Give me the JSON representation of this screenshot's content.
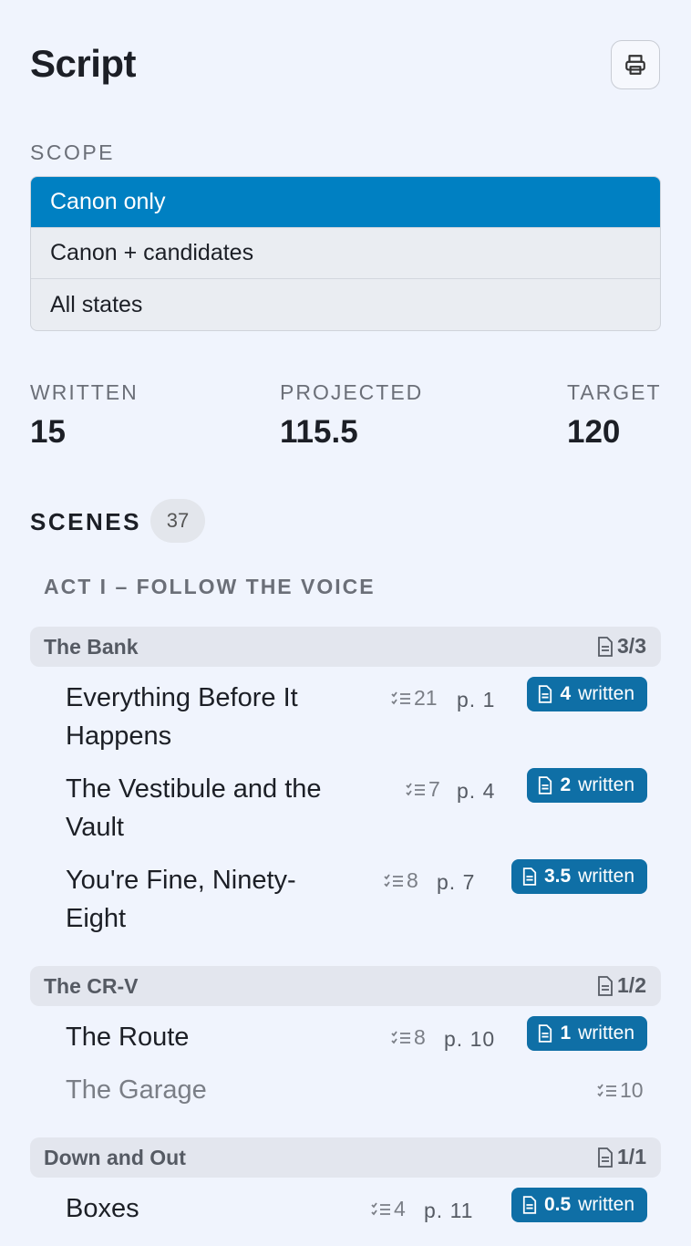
{
  "header": {
    "title": "Script",
    "print_icon": "printer-icon"
  },
  "scope": {
    "label": "SCOPE",
    "options": [
      "Canon only",
      "Canon + candidates",
      "All states"
    ],
    "selected": "Canon only"
  },
  "stats": {
    "written_label": "WRITTEN",
    "written_value": "15",
    "projected_label": "PROJECTED",
    "projected_value": "115.5",
    "target_label": "TARGET",
    "target_value": "120"
  },
  "scenes": {
    "label": "SCENES",
    "count": "37",
    "act": "ACT I – FOLLOW THE VOICE",
    "groups": [
      {
        "title": "The Bank",
        "count": "3/3",
        "items": [
          {
            "title_line1": "Everything Before It",
            "title_line2": "Happens",
            "beats": "21",
            "page": "p. 1",
            "written": "4",
            "written_label": "written"
          },
          {
            "title_line1": "The Vestibule and the",
            "title_line2": "Vault",
            "beats": "7",
            "page": "p. 4",
            "written": "2",
            "written_label": "written"
          },
          {
            "title_line1": "You're Fine, Ninety-",
            "title_line2": "Eight",
            "beats": "8",
            "page": "p. 7",
            "written": "3.5",
            "written_label": "written"
          }
        ]
      },
      {
        "title": "The CR-V",
        "count": "1/2",
        "items": [
          {
            "title_line1": "The Route",
            "beats": "8",
            "page": "p. 10",
            "written": "1",
            "written_label": "written"
          },
          {
            "title_line1": "The Garage",
            "beats": "10"
          }
        ]
      },
      {
        "title": "Down and Out",
        "count": "1/1",
        "items": [
          {
            "title_line1": "Boxes",
            "beats": "4",
            "page": "p. 11",
            "written": "0.5",
            "written_label": "written"
          }
        ]
      }
    ]
  },
  "colors": {
    "accent": "#0080c2",
    "badge": "#0f6fa6",
    "background": "#f0f4fd"
  }
}
